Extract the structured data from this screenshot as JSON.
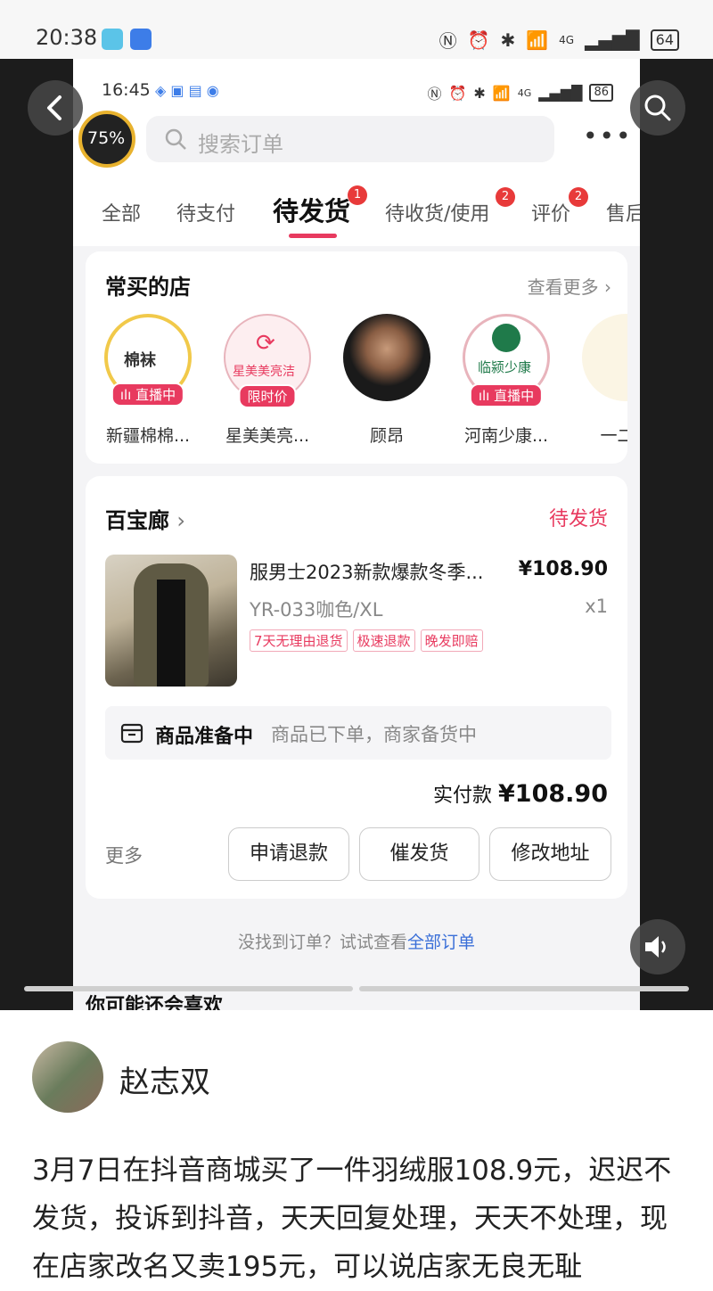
{
  "outer_status": {
    "time": "20:38",
    "battery": "64",
    "network": "4G"
  },
  "inner_status": {
    "time": "16:45",
    "battery": "86",
    "network": "4G"
  },
  "video_overlay": {
    "progress": "75%"
  },
  "search": {
    "placeholder": "搜索订单"
  },
  "tabs": [
    {
      "label": "全部",
      "badge": null
    },
    {
      "label": "待支付",
      "badge": null
    },
    {
      "label": "待发货",
      "badge": "1",
      "active": true
    },
    {
      "label": "待收货/使用",
      "badge": "2"
    },
    {
      "label": "评价",
      "badge": "2"
    },
    {
      "label": "售后",
      "badge": null
    }
  ],
  "shops": {
    "title": "常买的店",
    "see_more": "查看更多",
    "items": [
      {
        "name": "新疆棉棉...",
        "tag": "直播中",
        "logo_text": "棉袜"
      },
      {
        "name": "星美美亮...",
        "tag": "限时价",
        "logo_text": "星美美亮洁"
      },
      {
        "name": "顾昂",
        "tag": null,
        "logo_text": ""
      },
      {
        "name": "河南少康...",
        "tag": "直播中",
        "logo_text": "临颍少康"
      },
      {
        "name": "一二丫",
        "tag": null,
        "logo_text": ""
      }
    ]
  },
  "order": {
    "store": "百宝廊",
    "status": "待发货",
    "product_title": "服男士2023新款爆款冬季...",
    "price": "¥108.90",
    "sku": "YR-033咖色/XL",
    "qty": "x1",
    "service_tags": [
      "7天无理由退货",
      "极速退款",
      "晚发即赔"
    ],
    "progress_title": "商品准备中",
    "progress_desc": "商品已下单，商家备货中",
    "paid_label": "实付款",
    "paid_amount": "¥108.90",
    "more_label": "更多",
    "buttons": [
      "申请退款",
      "催发货",
      "修改地址"
    ]
  },
  "not_found": {
    "text": "没找到订单？试试查看",
    "link": "全部订单"
  },
  "recommend": {
    "title": "你可能还会喜欢"
  },
  "post": {
    "author": "赵志双",
    "text": "3月7日在抖音商城买了一件羽绒服108.9元，迟迟不发货，投诉到抖音，天天回复处理，天天不处理，现在店家改名又卖195元，可以说店家无良无耻"
  },
  "colors": {
    "accent": "#e83a5f",
    "link": "#3a6fd8"
  }
}
